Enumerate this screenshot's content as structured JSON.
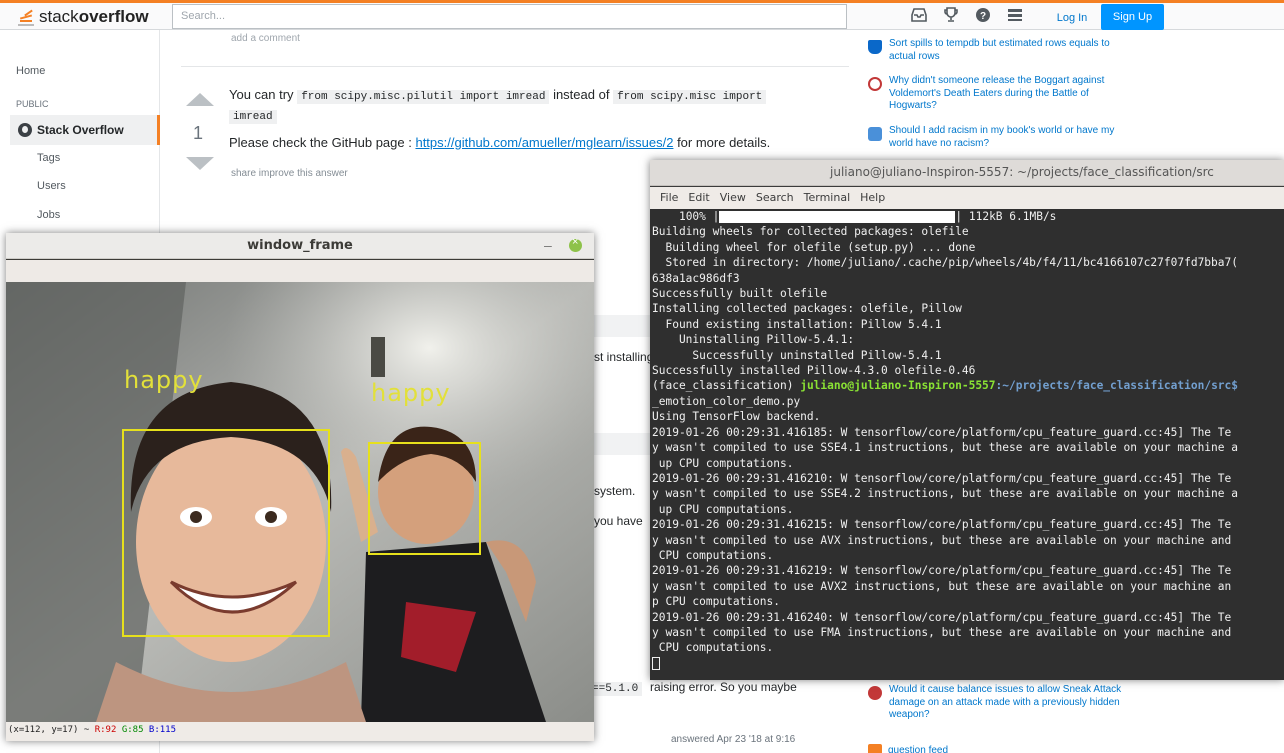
{
  "topbar": {
    "logo_light": "stack",
    "logo_bold": "overflow",
    "search_placeholder": "Search...",
    "login": "Log In",
    "signup": "Sign Up",
    "icons": [
      "inbox-icon",
      "achievements-icon",
      "help-icon",
      "review-icon"
    ]
  },
  "nav": {
    "home": "Home",
    "public": "PUBLIC",
    "stack_overflow": "Stack Overflow",
    "tags": "Tags",
    "users": "Users",
    "jobs": "Jobs"
  },
  "main": {
    "add_comment": "add a comment",
    "vote_count": "1",
    "answer_prefix": "You can try",
    "code1": "from scipy.misc.pilutil import imread",
    "answer_mid": "instead of",
    "code2a": "from scipy.misc import",
    "code2b": "imread",
    "check_prefix": "Please check the GitHub page :",
    "github_link": "https://github.com/amueller/mglearn/issues/2",
    "check_suffix": "for more details.",
    "share": "share",
    "improve": "improve this answer",
    "frag_installing": "st installing",
    "frag_system": "system.",
    "frag_youhave": "you have",
    "frag_code": "==5.1.0",
    "frag_raising": "raising error. So you maybe",
    "answered": "answered Apr 23 '18 at 9:16"
  },
  "sidebar": {
    "hot_questions": [
      {
        "text": "Sort spills to tempdb but estimated rows equals to actual rows",
        "color": "#0a68c9"
      },
      {
        "text": "Why didn't someone release the Boggart against Voldemort's Death Eaters during the Battle of Hogwarts?",
        "color": "#c23838"
      },
      {
        "text": "Should I add racism in my book's world or have my world have no racism?",
        "color": "#4a90d9"
      },
      {
        "text": "Would it cause balance issues to allow Sneak Attack damage on an attack made with a previously hidden weapon?",
        "color": "#c23838"
      }
    ],
    "feed": "question feed"
  },
  "window_frame": {
    "title": "window_frame",
    "minimize": "–",
    "labels": [
      "happy",
      "happy"
    ],
    "status_coord": "(x=112, y=17) ~",
    "status_r": "R:92",
    "status_g": "G:85",
    "status_b": "B:115"
  },
  "terminal": {
    "title": "juliano@juliano-Inspiron-5557: ~/projects/face_classification/src",
    "menu": [
      "File",
      "Edit",
      "View",
      "Search",
      "Terminal",
      "Help"
    ],
    "progress_pct": "100%",
    "progress_fraction": 1.0,
    "progress_suffix": "| 112kB 6.1MB/s",
    "prompt_env": "(face_classification)",
    "prompt_user": "juliano@juliano-Inspiron-5557",
    "prompt_path": ":~/projects/face_classification/src$",
    "lines": [
      "Building wheels for collected packages: olefile",
      "  Building wheel for olefile (setup.py) ... done",
      "  Stored in directory: /home/juliano/.cache/pip/wheels/4b/f4/11/bc4166107c27f07fd7bba7(",
      "638a1ac986df3",
      "Successfully built olefile",
      "Installing collected packages: olefile, Pillow",
      "  Found existing installation: Pillow 5.4.1",
      "    Uninstalling Pillow-5.4.1:",
      "      Successfully uninstalled Pillow-5.4.1",
      "Successfully installed Pillow-4.3.0 olefile-0.46"
    ],
    "lines2": [
      "_emotion_color_demo.py",
      "Using TensorFlow backend.",
      "2019-01-26 00:29:31.416185: W tensorflow/core/platform/cpu_feature_guard.cc:45] The Te",
      "y wasn't compiled to use SSE4.1 instructions, but these are available on your machine a",
      " up CPU computations.",
      "2019-01-26 00:29:31.416210: W tensorflow/core/platform/cpu_feature_guard.cc:45] The Te",
      "y wasn't compiled to use SSE4.2 instructions, but these are available on your machine a",
      " up CPU computations.",
      "2019-01-26 00:29:31.416215: W tensorflow/core/platform/cpu_feature_guard.cc:45] The Te",
      "y wasn't compiled to use AVX instructions, but these are available on your machine and",
      " CPU computations.",
      "2019-01-26 00:29:31.416219: W tensorflow/core/platform/cpu_feature_guard.cc:45] The Te",
      "y wasn't compiled to use AVX2 instructions, but these are available on your machine an",
      "p CPU computations.",
      "2019-01-26 00:29:31.416240: W tensorflow/core/platform/cpu_feature_guard.cc:45] The Te",
      "y wasn't compiled to use FMA instructions, but these are available on your machine and",
      " CPU computations."
    ]
  }
}
